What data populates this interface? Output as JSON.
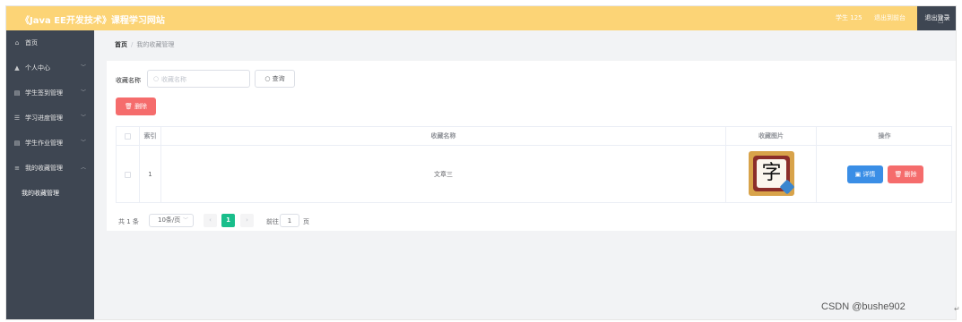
{
  "header": {
    "title": "《Java EE开发技术》课程学习网站",
    "user": "学生 125",
    "back_home": "退出到前台",
    "logout": "退出登录"
  },
  "sidebar": {
    "items": [
      {
        "label": "首页",
        "icon": "home-icon"
      },
      {
        "label": "个人中心",
        "icon": "user-icon",
        "chevron": "﹀"
      },
      {
        "label": "学生签到管理",
        "icon": "document-icon",
        "chevron": "﹀"
      },
      {
        "label": "学习进度管理",
        "icon": "list-icon",
        "chevron": "﹀"
      },
      {
        "label": "学生作业管理",
        "icon": "document-icon",
        "chevron": "﹀"
      },
      {
        "label": "我的收藏管理",
        "icon": "menu-icon",
        "chevron": "︿"
      }
    ],
    "subitem": "我的收藏管理"
  },
  "breadcrumb": {
    "home": "首页",
    "separator": "/",
    "current": "我的收藏管理"
  },
  "search": {
    "label": "收藏名称",
    "placeholder": "收藏名称",
    "value": "",
    "query_label": "查询"
  },
  "toolbar": {
    "delete_label": "删除"
  },
  "table": {
    "headers": {
      "index": "索引",
      "name": "收藏名称",
      "image": "收藏图片",
      "actions": "操作"
    },
    "rows": [
      {
        "index": "1",
        "name": "文章三",
        "image_char": "字",
        "detail_label": "详情",
        "delete_label": "删除"
      }
    ]
  },
  "pagination": {
    "total": "共 1 条",
    "page_size": "10条/页",
    "prev": "‹",
    "current_page": "1",
    "next": "›",
    "goto": "前往",
    "goto_value": "1",
    "page_unit": "页"
  },
  "watermark": "CSDN @bushe902",
  "colors": {
    "header_bg": "#fcd476",
    "sidebar_bg": "#3e4652",
    "danger": "#f56c6c",
    "primary": "#3a8ee6",
    "active_page": "#19be8b"
  }
}
